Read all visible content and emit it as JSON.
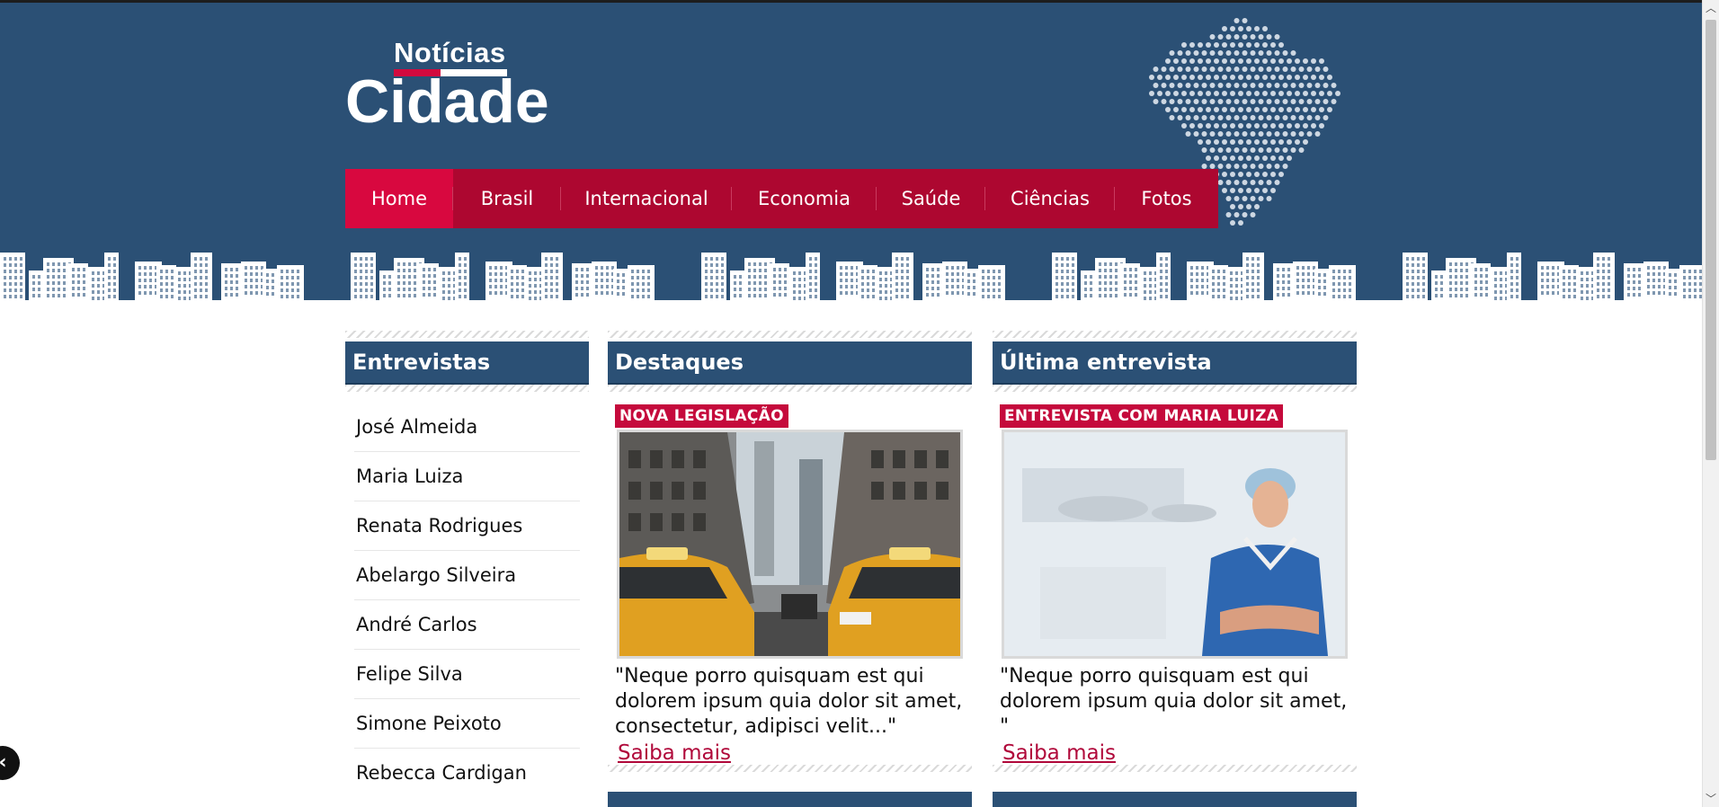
{
  "header": {
    "logo": {
      "top_text": "Notícias",
      "main_text": "Cidade"
    },
    "nav": [
      {
        "label": "Home",
        "active": true
      },
      {
        "label": "Brasil",
        "active": false
      },
      {
        "label": "Internacional",
        "active": false
      },
      {
        "label": "Economia",
        "active": false
      },
      {
        "label": "Saúde",
        "active": false
      },
      {
        "label": "Ciências",
        "active": false
      },
      {
        "label": "Fotos",
        "active": false
      }
    ]
  },
  "interviews": {
    "title": "Entrevistas",
    "items": [
      "José Almeida",
      "Maria Luiza",
      "Renata Rodrigues",
      "Abelargo Silveira",
      "André Carlos",
      "Felipe Silva",
      "Simone Peixoto",
      "Rebecca Cardigan"
    ]
  },
  "highlights": {
    "title": "Destaques",
    "badge": "NOVA LEGISLAÇÃO",
    "quote": "\"Neque porro quisquam est qui dolorem ipsum quia dolor sit amet, consectetur, adipisci velit...\"",
    "link": "Saiba mais"
  },
  "latest_interview": {
    "title": "Última entrevista",
    "badge": "ENTREVISTA COM MARIA LUIZA",
    "quote": "\"Neque porro quisquam est qui dolorem ipsum quia dolor sit amet, \"",
    "link": "Saiba mais"
  },
  "colors": {
    "header_blue": "#2b5075",
    "nav_red": "#ad0730",
    "nav_active": "#d8083f",
    "badge_red": "#c50a3c",
    "link_red": "#b0083a"
  },
  "icons": [
    "brazil-map-graphic",
    "city-skyline-graphic",
    "back-arrow-icon",
    "scroll-up-arrow-icon",
    "scroll-down-arrow-icon"
  ]
}
